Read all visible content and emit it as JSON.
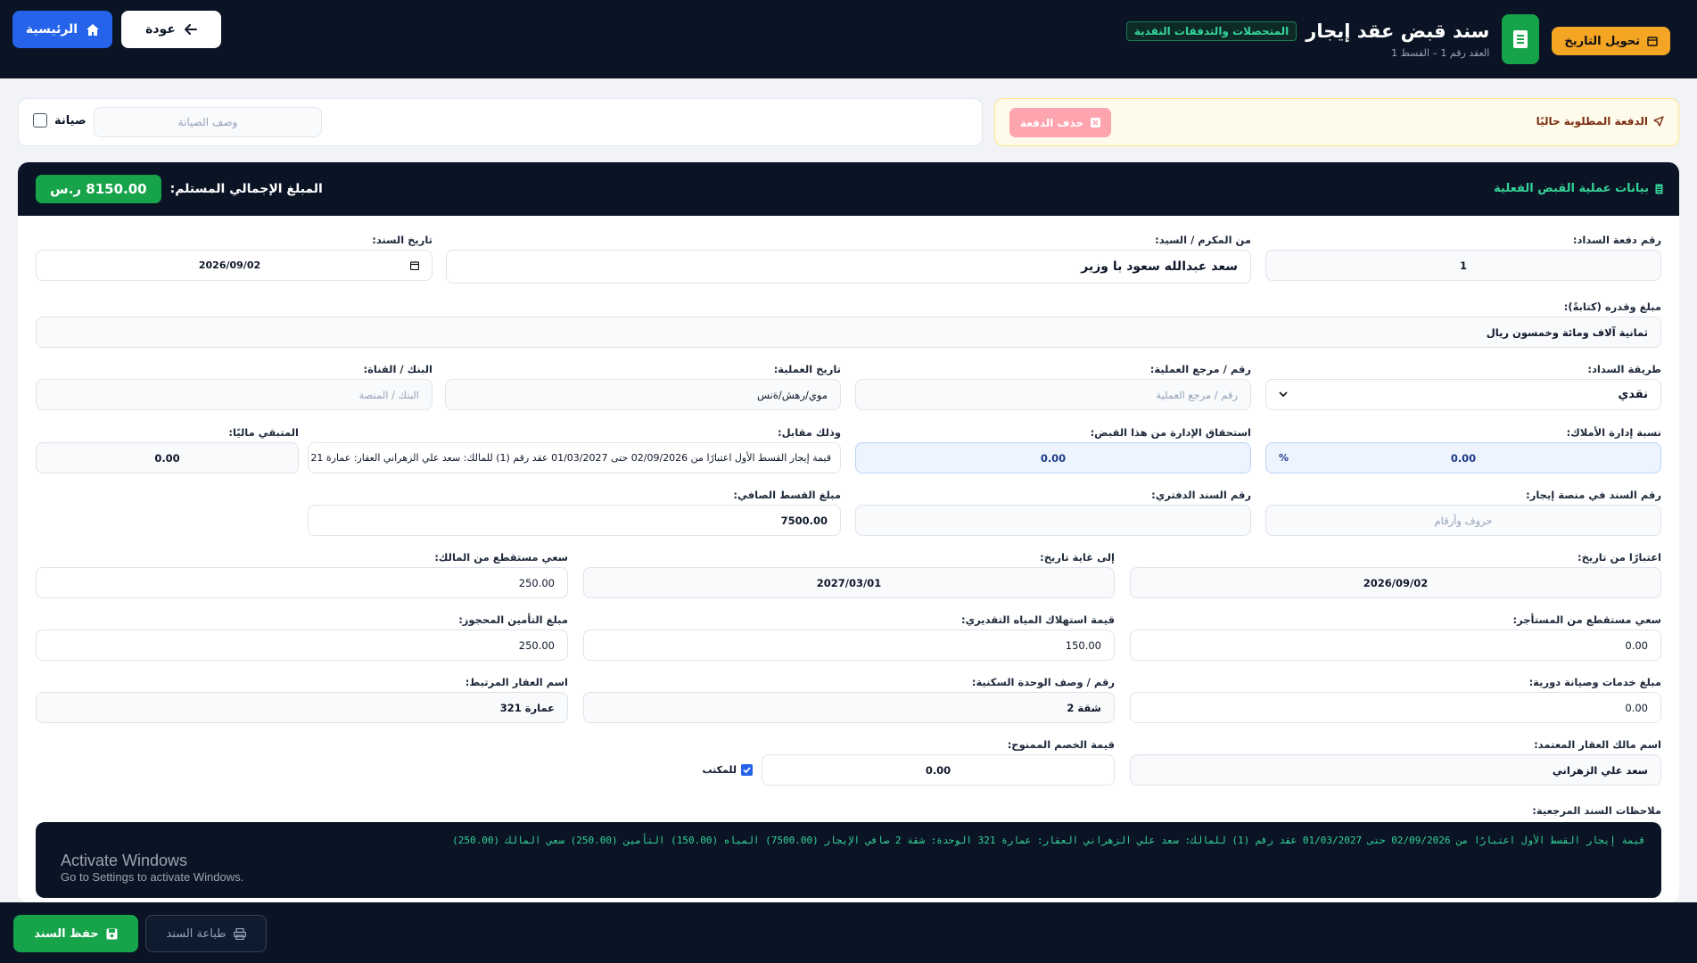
{
  "header": {
    "title": "سند قبض عقد إيجار",
    "category_badge": "المتحصلات والتدفقات النقدية",
    "subtitle": "العقد رقم 1 – القسط 1",
    "convert_date_button": "تحويل التاريخ",
    "home_button": "الرئيسية",
    "back_button": "عودة"
  },
  "alert": {
    "due_label": "الدفعة المطلوبة حاليًا",
    "delete_button": "حذف الدفعة"
  },
  "maintenance": {
    "checkbox_label": "صيانة",
    "description_placeholder": "وصف الصيانة"
  },
  "card": {
    "section_title": "بيانات عملية القبض الفعلية",
    "total_label": "المبلغ الإجمالي المستلم:",
    "total_value": "8150.00 ر.س"
  },
  "form": {
    "payment_number": {
      "label": "رقم دفعة السداد:",
      "value": "1"
    },
    "from_sir": {
      "label": "من المكرم / السيد:",
      "value": "سعد عبدالله سعود با وزير"
    },
    "receipt_date": {
      "label": "تاريخ السند:",
      "value": "2026/09/02"
    },
    "amount_words": {
      "label": "مبلغ وقدره (كتابةً):",
      "value": "ثمانية آلاف ومائة وخمسون ريال"
    },
    "payment_method": {
      "label": "طريقة السداد:",
      "value": "نقدي"
    },
    "operation_ref": {
      "label": "رقم / مرجع العملية:",
      "placeholder": "رقم / مرجع العملية"
    },
    "operation_date": {
      "label": "تاريخ العملية:",
      "value": "موي/رهش/ةنس"
    },
    "bank_channel": {
      "label": "البنك / القناة:",
      "placeholder": "البنك / المنصة"
    },
    "mgmt_ratio": {
      "label": "نسبة إدارة الأملاك:",
      "value": "0.00",
      "suffix": "%"
    },
    "mgmt_due": {
      "label": "استحقاق الإدارة من هذا القبض:",
      "value": "0.00"
    },
    "in_return": {
      "label": "وذلك مقابل:",
      "value": "قيمة إيجار القسط الأول اعتبارًا من 02/09/2026 حتى 01/03/2027 عقد رقم (1) للمالك: سعد علي الزهراني العقار: عمارة 21"
    },
    "remaining": {
      "label": "المتبقي ماليًا:",
      "value": "0.00"
    },
    "ejar_receipt_no": {
      "label": "رقم السند في منصة إيجار:",
      "placeholder": "حروف وأرقام"
    },
    "book_receipt_no": {
      "label": "رقم السند الدفتري:",
      "value": ""
    },
    "net_installment": {
      "label": "مبلغ القسط الصافي:",
      "value": "7500.00"
    },
    "from_date": {
      "label": "اعتبارًا من تاريخ:",
      "value": "2026/09/02"
    },
    "to_date": {
      "label": "إلى غاية تاريخ:",
      "value": "2027/03/01"
    },
    "commission_owner": {
      "label": "سعي مستقطع من المالك:",
      "value": "250.00"
    },
    "commission_tenant": {
      "label": "سعي مستقطع من المستأجر:",
      "value": "0.00"
    },
    "water_estimate": {
      "label": "قيمة استهلاك المياه التقديري:",
      "value": "150.00"
    },
    "insurance": {
      "label": "مبلغ التأمين المحجوز:",
      "value": "250.00"
    },
    "services_fee": {
      "label": "مبلغ خدمات وصيانة دورية:",
      "value": "0.00"
    },
    "unit_desc": {
      "label": "رقم / وصف الوحدة السكنية:",
      "value": "شقة 2"
    },
    "property_name": {
      "label": "اسم العقار المرتبط:",
      "value": "عمارة 321"
    },
    "owner_name": {
      "label": "اسم مالك العقار المعتمد:",
      "value": "سعد علي الزهراني"
    },
    "discount": {
      "label": "قيمة الخصم الممنوح:",
      "value": "0.00"
    },
    "office_label": "للمكتب",
    "notes_label": "ملاحظات السند المرجعية:",
    "notes_value": "قيمة إيجار القسط الأول اعتبارًا من 02/09/2026 حتى 01/03/2027 عقد رقم (1) للمالك: سعد علي الزهراني العقار: عمارة 321 الوحدة: شقة 2 صافي الإيجار (7500.00) المياه (150.00) التأمين (250.00) سعي المالك (250.00)"
  },
  "watermark": {
    "line1": "Activate Windows",
    "line2": "Go to Settings to activate Windows."
  },
  "footer": {
    "save_button": "حفظ السند",
    "print_button": "طباعة السند"
  },
  "colors": {
    "dark_bg": "#0b1424",
    "accent_green": "#16a34a",
    "accent_blue": "#2563eb",
    "accent_orange": "#f5a524"
  }
}
